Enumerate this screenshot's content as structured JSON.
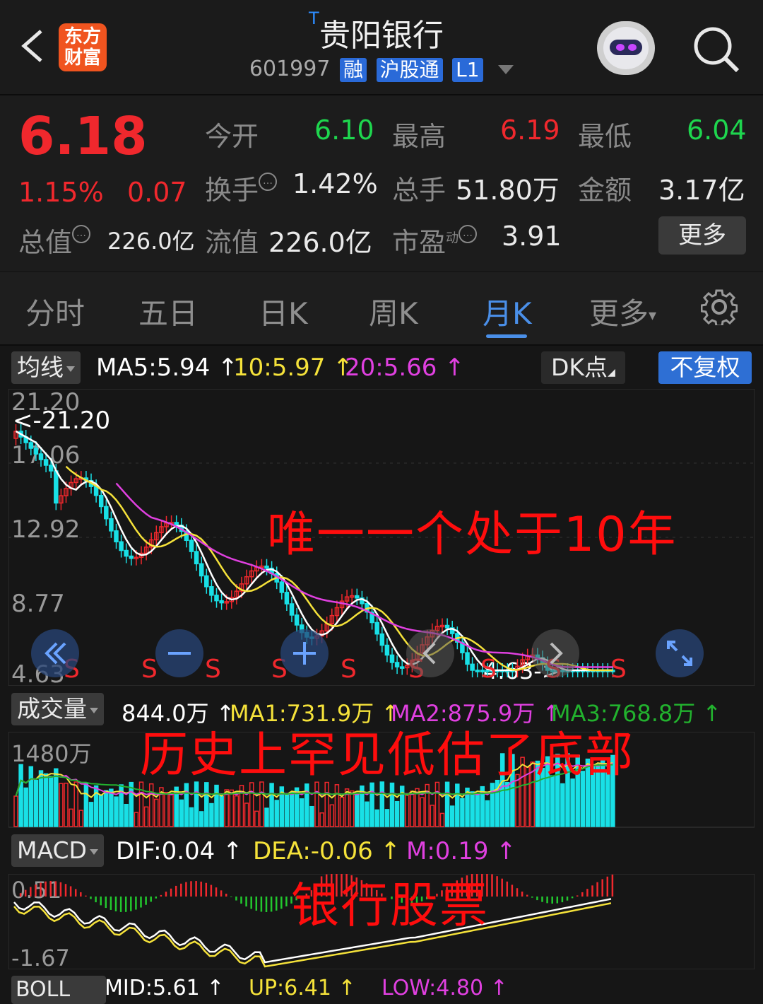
{
  "header": {
    "title": "贵阳银行",
    "title_marker": "T",
    "logo_line1": "东方",
    "logo_line2": "财富",
    "code": "601997",
    "tags": [
      "融",
      "沪股通",
      "L1"
    ]
  },
  "quote": {
    "price": "6.18",
    "change_pct": "1.15%",
    "change": "0.07",
    "open_label": "今开",
    "open": "6.10",
    "high_label": "最高",
    "high": "6.19",
    "low_label": "最低",
    "low": "6.04",
    "turnover_label": "换手",
    "turnover": "1.42%",
    "volume_label": "总手",
    "volume": "51.80万",
    "amount_label": "金额",
    "amount": "3.17亿",
    "mcap_label": "总值",
    "mcap": "226.0亿",
    "float_label": "流值",
    "float_mcap": "226.0亿",
    "pe_label": "市盈",
    "pe_sup": "动",
    "pe": "3.91",
    "more_label": "更多"
  },
  "tabs": [
    {
      "label": "分时"
    },
    {
      "label": "五日"
    },
    {
      "label": "日K"
    },
    {
      "label": "周K"
    },
    {
      "label": "月K"
    },
    {
      "label": "更多"
    }
  ],
  "active_tab": "月K",
  "kline": {
    "indicator": "均线",
    "ma5": "MA5:5.94 ↑",
    "ma10": "10:5.97 ↑",
    "ma20": "20:5.66 ↑",
    "dk_label": "DK点",
    "adjust_label": "不复权",
    "y_labels": [
      "21.20",
      "17.06",
      "12.92",
      "8.77",
      "4.63"
    ],
    "max_note": "<-21.20",
    "min_note": "4.63->",
    "s_marker": "S",
    "colors": {
      "ma5": "#ffffff",
      "ma10": "#f5e23a",
      "ma20": "#e040e0",
      "up": "#f0282d",
      "down": "#19e0e6"
    }
  },
  "volume": {
    "indicator": "成交量",
    "value": "844.0万 ↑",
    "ma1": "MA1:731.9万 ↑",
    "ma2": "MA2:875.9万 ↑",
    "ma3": "MA3:768.8万 ↑",
    "y_label": "1480万",
    "colors": {
      "ma1": "#f5e23a",
      "ma2": "#e040e0",
      "ma3": "#22b22e"
    }
  },
  "macd": {
    "indicator": "MACD",
    "dif": "DIF:0.04 ↑",
    "dea": "DEA:-0.06 ↑",
    "m": "M:0.19 ↑",
    "y_top": "0.51",
    "y_bottom": "-1.67"
  },
  "bottom_row": {
    "indicator": "BOLL",
    "mid": "MID:5.61 ↑",
    "up": "UP:6.41 ↑",
    "low": "LOW:4.80 ↑"
  },
  "overlay": {
    "line1": "唯一一个处于10年",
    "line2": "历史上罕见低估了底部",
    "line3": "银行股票"
  },
  "icons": [
    "back-arrow-icon",
    "robot-avatar-icon",
    "search-icon",
    "gear-icon",
    "double-left-icon",
    "zoom-out-icon",
    "zoom-in-icon",
    "left-icon",
    "right-icon",
    "expand-icon"
  ]
}
